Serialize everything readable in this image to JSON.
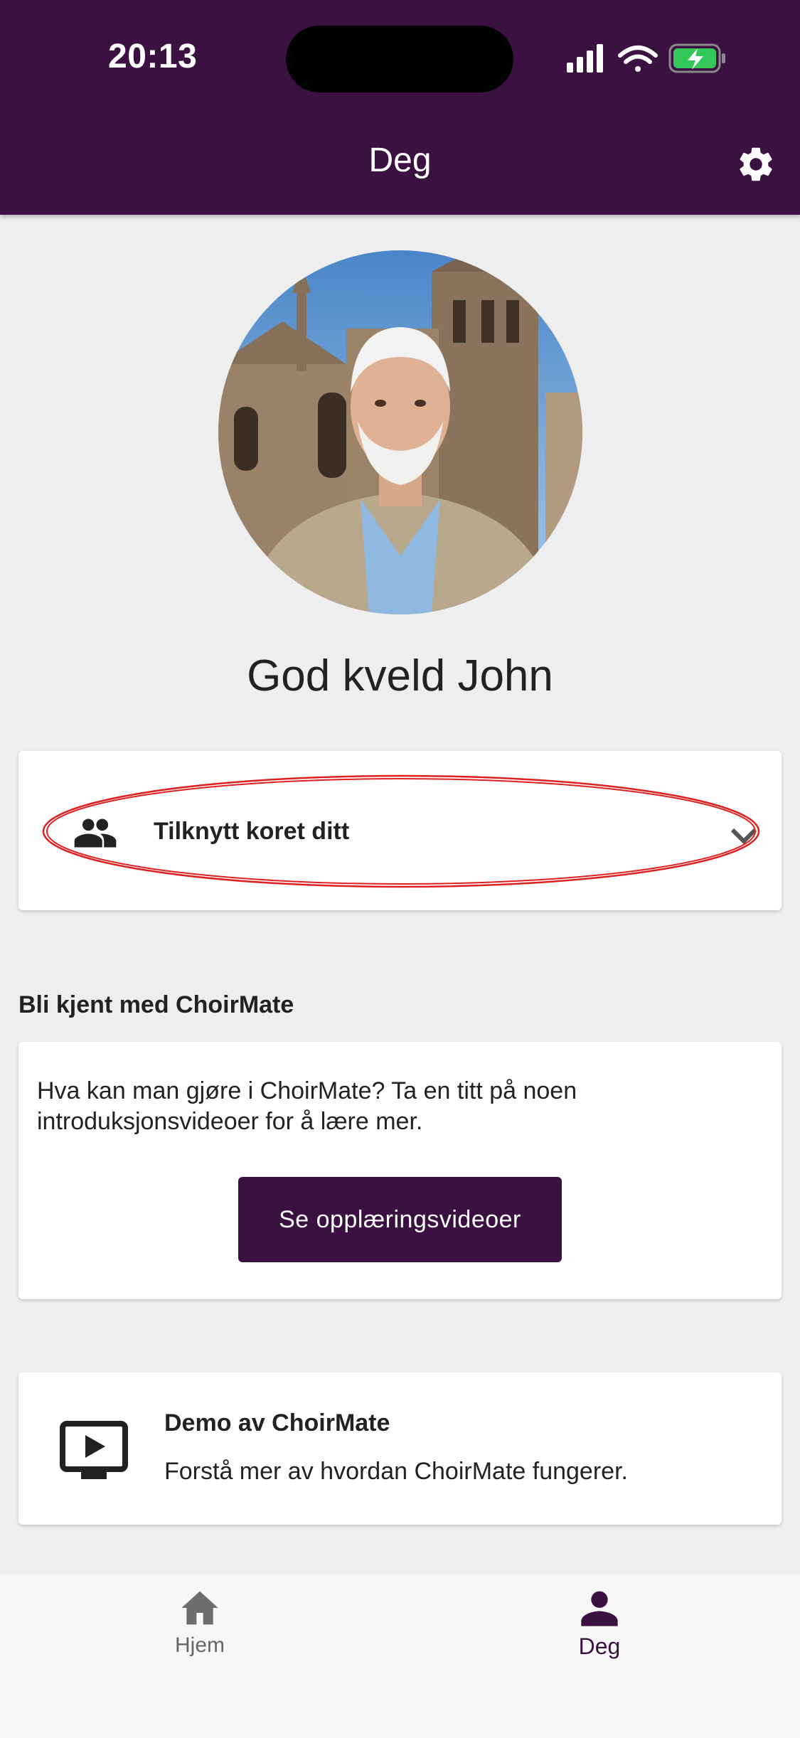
{
  "status_bar": {
    "time": "20:13"
  },
  "app_bar": {
    "title": "Deg"
  },
  "profile": {
    "greeting": "God kveld John"
  },
  "join_choir": {
    "label": "Tilknytt koret ditt"
  },
  "intro_section": {
    "title": "Bli kjent med ChoirMate",
    "text": "Hva kan man gjøre i ChoirMate? Ta en titt på noen introduksjonsvideoer for å lære mer.",
    "button_label": "Se opplæringsvideoer"
  },
  "demo": {
    "title": "Demo av ChoirMate",
    "subtitle": "Forstå mer av hvordan ChoirMate fungerer."
  },
  "bottom_nav": {
    "items": [
      {
        "label": "Hjem",
        "icon": "home-icon",
        "active": false
      },
      {
        "label": "Deg",
        "icon": "person-icon",
        "active": true
      }
    ]
  },
  "colors": {
    "brand": "#3a1140",
    "background": "#eeeeee",
    "highlight_annotation": "#e02020",
    "battery": "#34c759"
  }
}
